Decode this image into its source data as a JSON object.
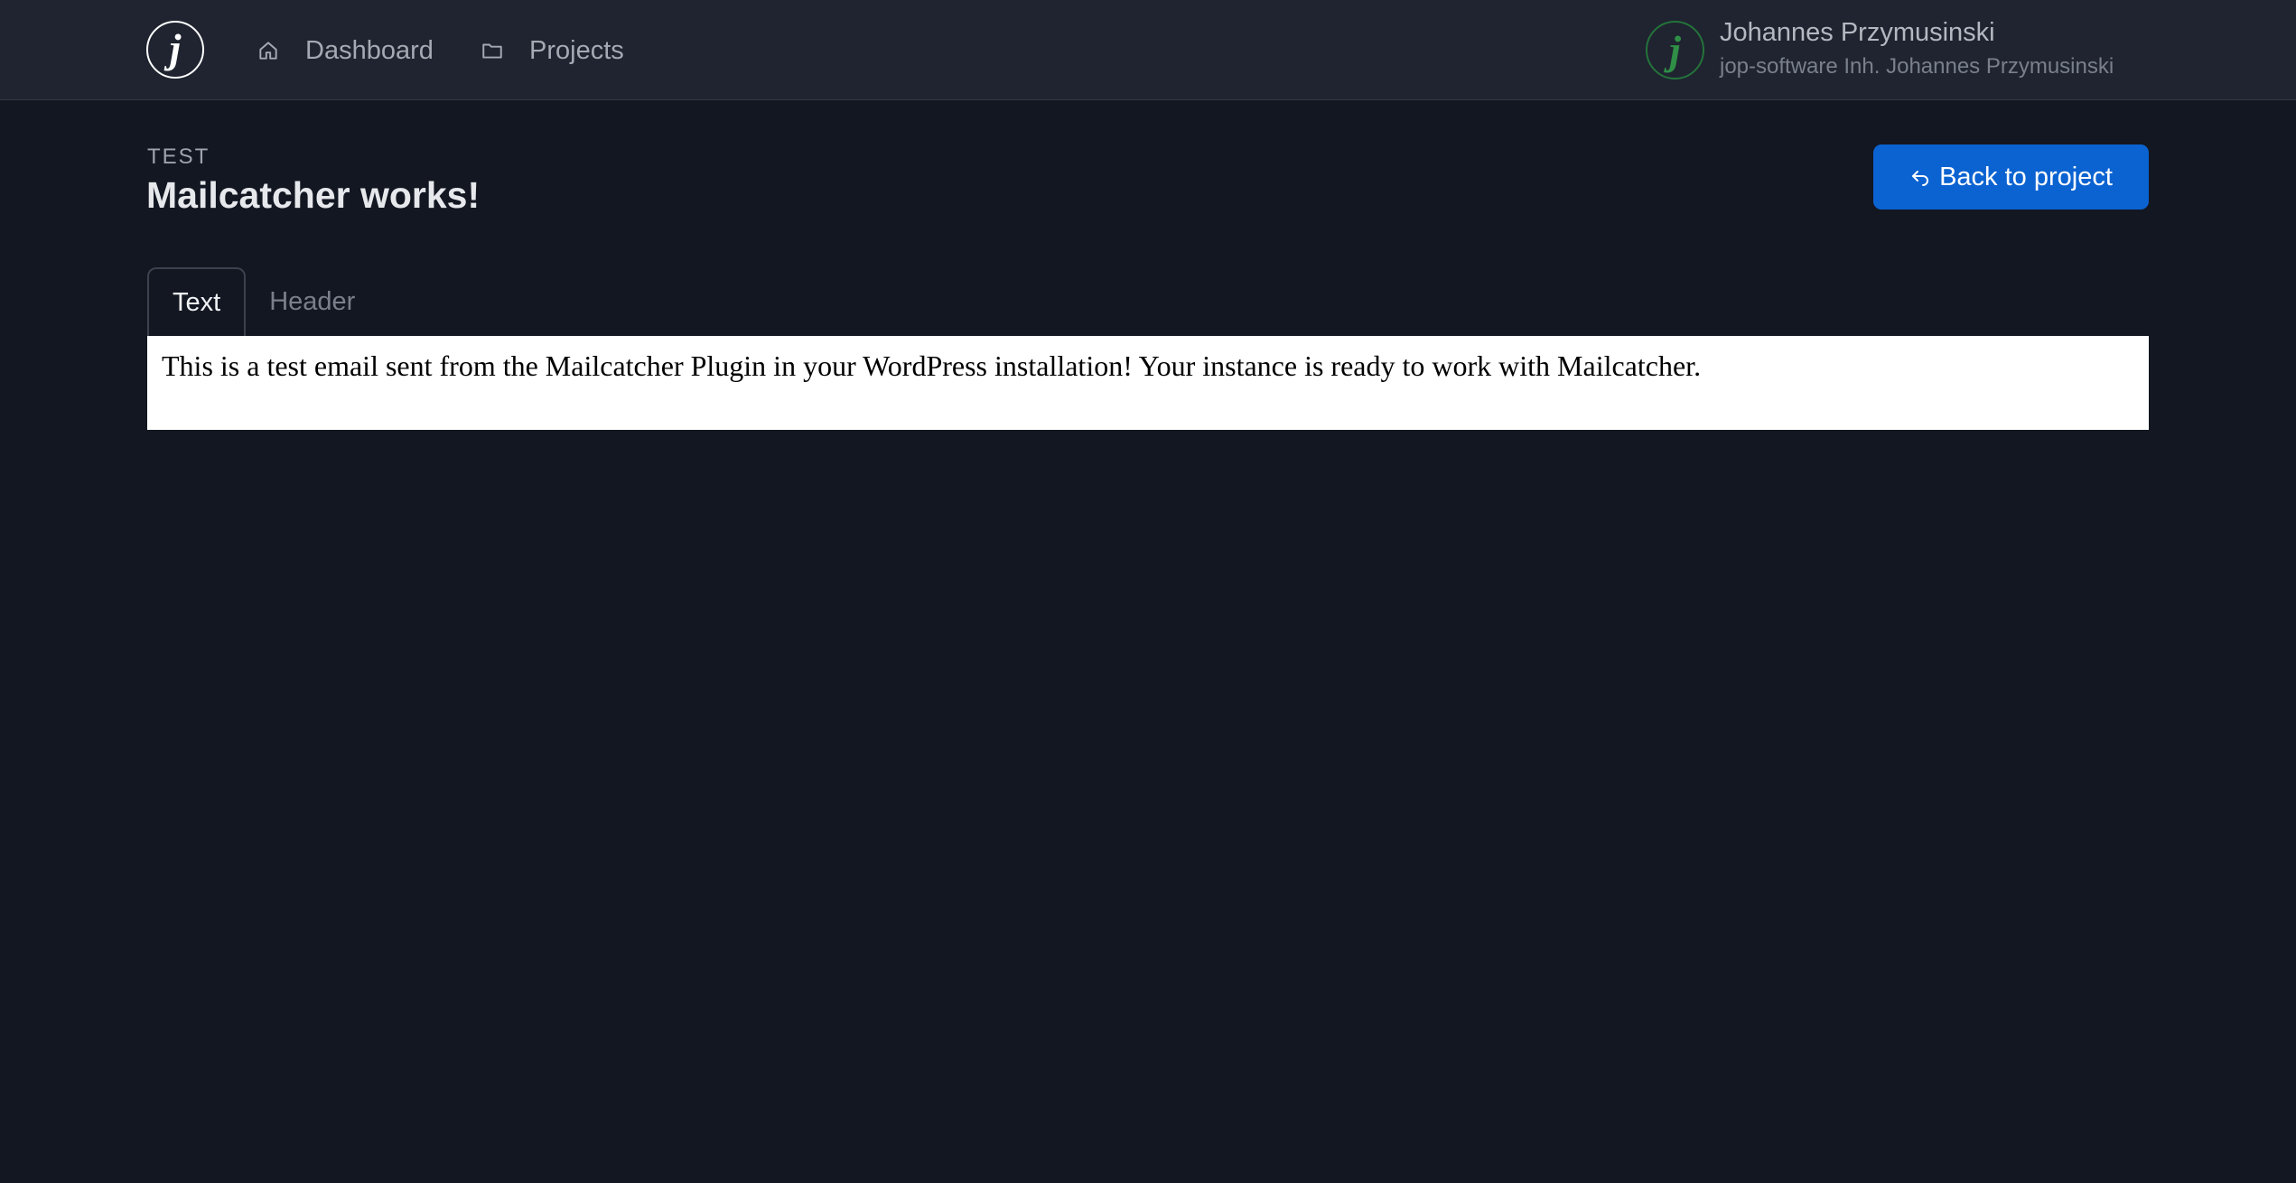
{
  "header": {
    "logo_glyph": "j",
    "nav": [
      {
        "label": "Dashboard",
        "icon": "home-icon"
      },
      {
        "label": "Projects",
        "icon": "folder-icon"
      }
    ],
    "user": {
      "avatar_glyph": "j",
      "name": "Johannes Przymusinski",
      "company": "jop-software Inh. Johannes Przymusinski"
    }
  },
  "page": {
    "eyebrow": "TEST",
    "title": "Mailcatcher works!",
    "back_button_label": "Back to project",
    "back_button_icon": "reply-arrow-icon"
  },
  "tabs": [
    {
      "label": "Text",
      "active": true
    },
    {
      "label": "Header",
      "active": false
    }
  ],
  "mail": {
    "body": "This is a test email sent from the Mailcatcher Plugin in your WordPress installation! Your instance is ready to work with Mailcatcher."
  },
  "colors": {
    "background": "#131722",
    "topbar": "#1f2430",
    "accent": "#0b63d1",
    "avatar_green": "#2f8f46"
  }
}
